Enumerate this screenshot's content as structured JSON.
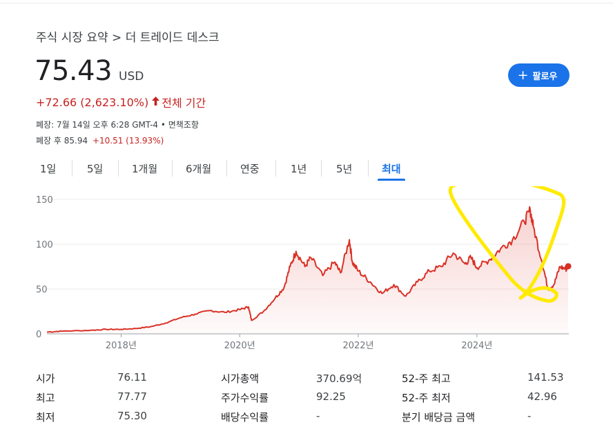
{
  "breadcrumb": "주식 시장 요약 > 더 트레이드 데스크",
  "quote": {
    "price": "75.43",
    "currency": "USD",
    "change": "+72.66 (2,623.10%)",
    "change_icon": "arrow-up-icon",
    "period": "전체 기간",
    "closed_info": "폐장: 7월 14일 오후 6:28 GMT-4 • 면책조항",
    "after_hours_label": "폐장 후 85.94",
    "after_hours_change": "+10.51 (13.93%)"
  },
  "follow_button": {
    "label": "팔로우",
    "icon": "plus-icon",
    "color": "#1a73e8"
  },
  "tabs": [
    {
      "label": "1일"
    },
    {
      "label": "5일"
    },
    {
      "label": "1개월"
    },
    {
      "label": "6개월"
    },
    {
      "label": "연중"
    },
    {
      "label": "1년"
    },
    {
      "label": "5년"
    },
    {
      "label": "최대",
      "active": true
    }
  ],
  "chart_data": {
    "type": "area",
    "line_color": "#d93025",
    "annotation_color": "#ffea00",
    "ylim": [
      0,
      150
    ],
    "yticks": [
      "150",
      "100",
      "50",
      "0"
    ],
    "xticks": [
      "2018년",
      "2020년",
      "2022년",
      "2024년"
    ],
    "series": [
      {
        "x": [
          2016.75,
          2017.0,
          2017.5,
          2017.75,
          2018.0,
          2018.25,
          2018.5,
          2018.75,
          2019.0,
          2019.25,
          2019.5,
          2019.75,
          2020.0,
          2020.15,
          2020.2,
          2020.4,
          2020.6,
          2020.75,
          2020.85,
          2020.95,
          2021.1,
          2021.2,
          2021.4,
          2021.6,
          2021.7,
          2021.85,
          2021.9,
          2022.0,
          2022.2,
          2022.4,
          2022.6,
          2022.8,
          2023.0,
          2023.2,
          2023.4,
          2023.6,
          2023.8,
          2023.9,
          2024.0,
          2024.2,
          2024.4,
          2024.6,
          2024.8,
          2024.9,
          2024.95,
          2025.1,
          2025.2,
          2025.3,
          2025.4,
          2025.5,
          2025.54
        ],
        "y": [
          2,
          3,
          4,
          5,
          5,
          6,
          8,
          12,
          18,
          22,
          26,
          24,
          27,
          30,
          15,
          25,
          40,
          52,
          75,
          92,
          75,
          85,
          65,
          80,
          68,
          105,
          80,
          70,
          58,
          45,
          55,
          42,
          58,
          70,
          75,
          90,
          78,
          85,
          74,
          82,
          95,
          105,
          125,
          138,
          120,
          80,
          50,
          55,
          75,
          72,
          75.43
        ]
      }
    ]
  },
  "stats": [
    {
      "label": "시가",
      "value": "76.11"
    },
    {
      "label": "최고",
      "value": "77.77"
    },
    {
      "label": "최저",
      "value": "75.30"
    },
    {
      "label": "시가총액",
      "value": "370.69억"
    },
    {
      "label": "주가수익률",
      "value": "92.25"
    },
    {
      "label": "배당수익률",
      "value": "-"
    },
    {
      "label": "52-주 최고",
      "value": "141.53"
    },
    {
      "label": "52-주 최저",
      "value": "42.96"
    },
    {
      "label": "분기 배당금 금액",
      "value": "-"
    }
  ]
}
